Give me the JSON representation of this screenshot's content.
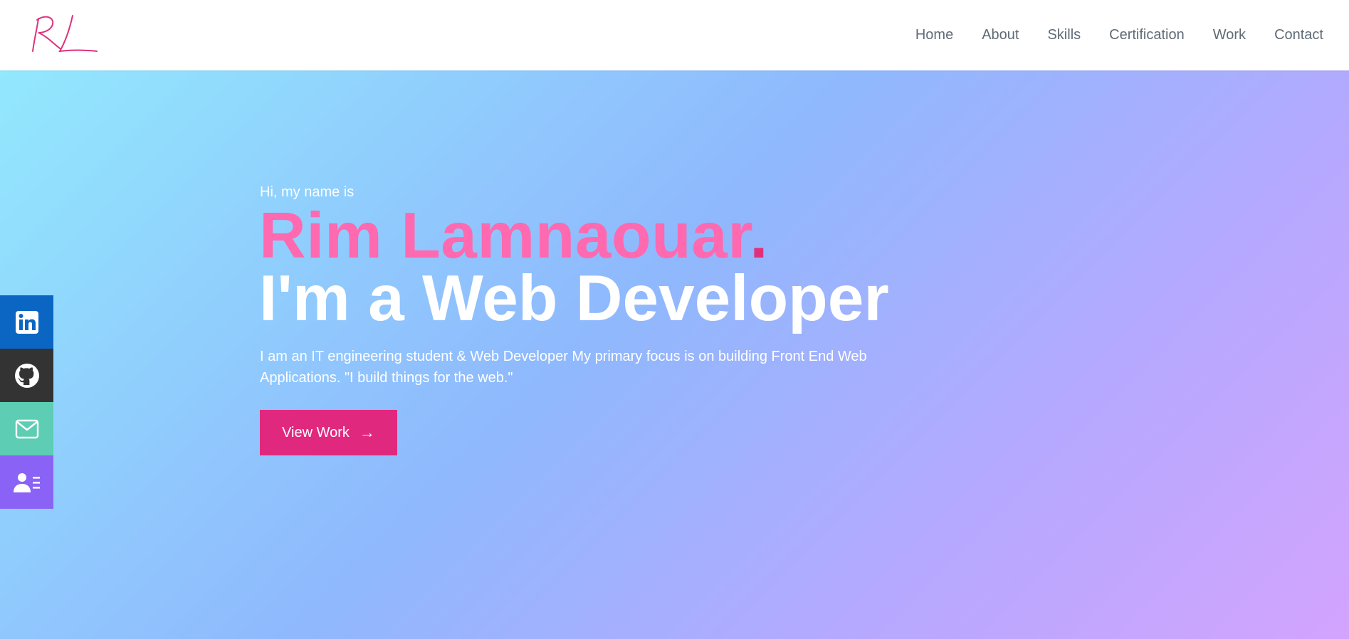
{
  "header": {
    "logo_text": "RL",
    "nav": [
      {
        "label": "Home"
      },
      {
        "label": "About"
      },
      {
        "label": "Skills"
      },
      {
        "label": "Certification"
      },
      {
        "label": "Work"
      },
      {
        "label": "Contact"
      }
    ]
  },
  "social": [
    {
      "icon": "linkedin-icon",
      "color": "#0a66c2"
    },
    {
      "icon": "github-icon",
      "color": "#333333"
    },
    {
      "icon": "mail-icon",
      "color": "#5dcdb3"
    },
    {
      "icon": "resume-icon",
      "color": "#8a63f6"
    }
  ],
  "hero": {
    "intro": "Hi, my name is",
    "name": "Rim Lamnaouar",
    "name_dot": ".",
    "role": "I'm a Web Developer",
    "description": "I am an IT engineering student & Web Developer My primary focus is on building Front End Web Applications. \"I build things for the web.\"",
    "cta_label": "View Work",
    "cta_arrow": "→"
  },
  "colors": {
    "accent": "#e0297e",
    "name_pink": "#ff69b0",
    "nav_text": "#5f6b76"
  }
}
